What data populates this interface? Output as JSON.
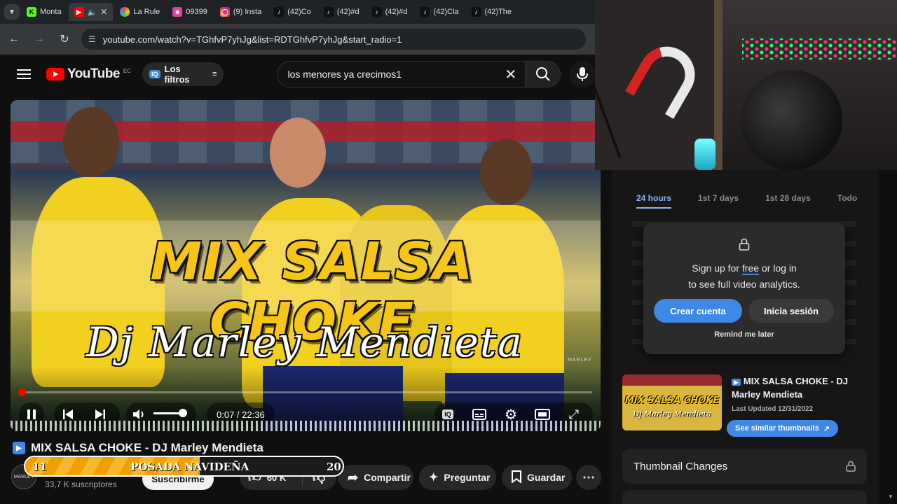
{
  "browser": {
    "tabs": [
      {
        "label": "Monta",
        "icon": "kick-icon",
        "color": "#53fc18"
      },
      {
        "label": "",
        "icon": "youtube-icon",
        "color": "#ff0000",
        "active": true
      },
      {
        "label": "La Rule",
        "icon": "wheel-icon",
        "color": "#ff8a00"
      },
      {
        "label": "09399",
        "icon": "contact-icon",
        "color": "#e040a0"
      },
      {
        "label": "(9) Insta",
        "icon": "instagram-icon",
        "color": "#e1306c"
      },
      {
        "label": "(42)Co",
        "icon": "tiktok-icon",
        "color": "#111111"
      },
      {
        "label": "(42)#d",
        "icon": "tiktok-icon",
        "color": "#111111"
      },
      {
        "label": "(42)#d",
        "icon": "tiktok-icon",
        "color": "#111111"
      },
      {
        "label": "(42)Cla",
        "icon": "tiktok-icon",
        "color": "#111111"
      },
      {
        "label": "(42)The",
        "icon": "tiktok-icon",
        "color": "#111111"
      }
    ],
    "url": "youtube.com/watch?v=TGhfvP7yhJg&list=RDTGhfvP7yhJg&start_radio=1"
  },
  "yt": {
    "logo": "YouTube",
    "country": "EC",
    "filters_label": "Los filtros",
    "search_query": "los menores ya crecimos1"
  },
  "video": {
    "overlay_title": "MIX SALSA CHOKE",
    "overlay_subtitle": "Dj Marley Mendieta",
    "watermark": "MARLEY",
    "time": "0:07 / 22:36",
    "progress": 0.005
  },
  "meta": {
    "title": "MIX SALSA CHOKE - DJ Marley Mendieta",
    "subscribers": "33,7 K suscriptores",
    "subscribe_label": "Suscribirme",
    "likes": "60 K",
    "share_label": "Compartir",
    "ask_label": "Preguntar",
    "save_label": "Guardar",
    "avatar_text": "MARLEY"
  },
  "overlay_bar": {
    "left_value": "11",
    "label": "POSADA NAVIDEÑA",
    "right_value": "20",
    "fill": 0.55
  },
  "analytics": {
    "tabs": [
      "24 hours",
      "1st 7 days",
      "1st 28 days",
      "Todo"
    ],
    "modal_line1_pre": "Sign up for ",
    "modal_line1_link": "free",
    "modal_line1_post": " or log in",
    "modal_line2": "to see full video analytics.",
    "create_label": "Crear cuenta",
    "login_label": "Inicia sesión",
    "remind_label": "Remind me later",
    "thumb_title": "MIX SALSA CHOKE - DJ Marley Mendieta",
    "thumb_overlay_1": "MIX SALSA CHOKE",
    "thumb_overlay_2": "Dj Marley Mendieta",
    "last_updated": "Last Updated 12/31/2022",
    "similar_label": "See similar thumbnails",
    "changes_label": "Thumbnail Changes"
  }
}
